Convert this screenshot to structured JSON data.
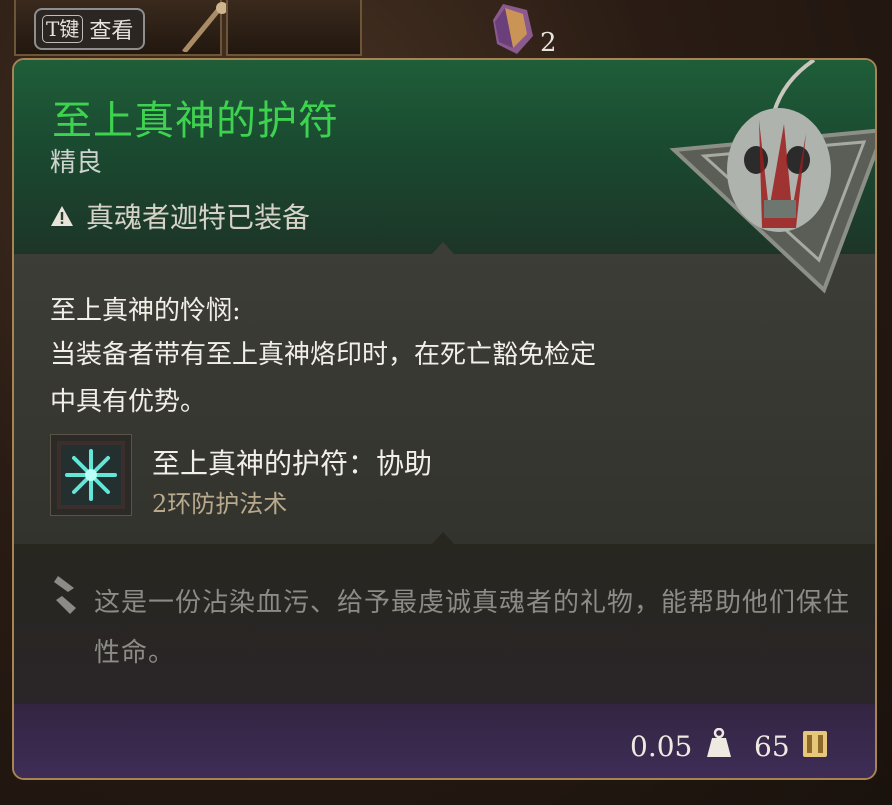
{
  "topbar": {
    "key_label": "T键",
    "view_label": "查看",
    "slot_count": "2"
  },
  "item": {
    "name": "至上真神的护符",
    "rarity": "精良",
    "equipped_by": "真魂者迦特已装备",
    "passive": {
      "title": "至上真神的怜悯:",
      "description": "当装备者带有至上真神烙印时，在死亡豁免检定中具有优势。"
    },
    "spell": {
      "name": "至上真神的护符：协助",
      "type": "2环防护法术"
    },
    "lore": "这是一份沾染血污、给予最虔诚真魂者的礼物，能帮助他们保住性命。",
    "weight": "0.05",
    "value": "65"
  },
  "colors": {
    "title": "#3ed34f",
    "header_bg": "#1f5e39",
    "footer_bg": "#3f2d57",
    "border": "#a68553"
  },
  "icons": {
    "warning": "warning-icon",
    "spell": "radiant-star-icon",
    "lore": "quill-icon",
    "weight": "weight-icon",
    "value": "gold-coin-icon"
  }
}
